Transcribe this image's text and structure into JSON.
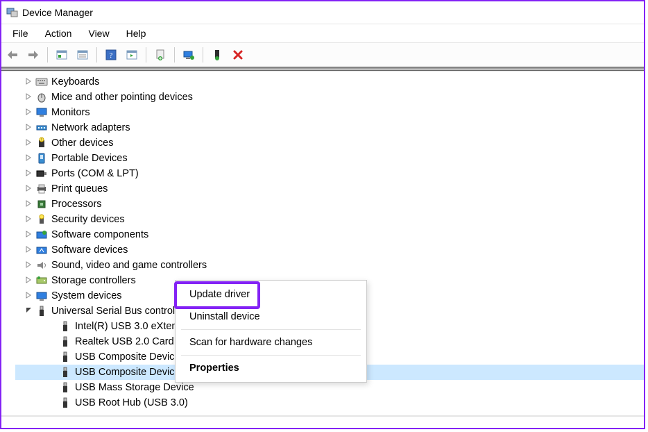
{
  "window": {
    "title": "Device Manager"
  },
  "menubar": {
    "file": "File",
    "action": "Action",
    "view": "View",
    "help": "Help"
  },
  "tree": {
    "items": [
      {
        "label": "Keyboards",
        "icon": "keyboard"
      },
      {
        "label": "Mice and other pointing devices",
        "icon": "mouse"
      },
      {
        "label": "Monitors",
        "icon": "monitor"
      },
      {
        "label": "Network adapters",
        "icon": "net"
      },
      {
        "label": "Other devices",
        "icon": "other"
      },
      {
        "label": "Portable Devices",
        "icon": "portable"
      },
      {
        "label": "Ports (COM & LPT)",
        "icon": "port"
      },
      {
        "label": "Print queues",
        "icon": "printer"
      },
      {
        "label": "Processors",
        "icon": "cpu"
      },
      {
        "label": "Security devices",
        "icon": "security"
      },
      {
        "label": "Software components",
        "icon": "swcomp"
      },
      {
        "label": "Software devices",
        "icon": "swdev"
      },
      {
        "label": "Sound, video and game controllers",
        "icon": "sound"
      },
      {
        "label": "Storage controllers",
        "icon": "storage"
      },
      {
        "label": "System devices",
        "icon": "system"
      },
      {
        "label": "Universal Serial Bus controllers",
        "icon": "usb",
        "expanded": true,
        "children": [
          {
            "label": "Intel(R) USB 3.0 eXten",
            "icon": "usb-plug"
          },
          {
            "label": "Realtek USB 2.0 Card",
            "icon": "usb-plug"
          },
          {
            "label": "USB Composite Device",
            "icon": "usb-plug"
          },
          {
            "label": "USB Composite Device",
            "icon": "usb-plug",
            "selected": true
          },
          {
            "label": "USB Mass Storage Device",
            "icon": "usb-plug"
          },
          {
            "label": "USB Root Hub (USB 3.0)",
            "icon": "usb-plug"
          }
        ]
      }
    ]
  },
  "context_menu": {
    "items": [
      {
        "label": "Update driver",
        "highlight": true
      },
      {
        "label": "Uninstall device"
      },
      {
        "sep": true
      },
      {
        "label": "Scan for hardware changes"
      },
      {
        "sep": true
      },
      {
        "label": "Properties",
        "bold": true
      }
    ]
  }
}
